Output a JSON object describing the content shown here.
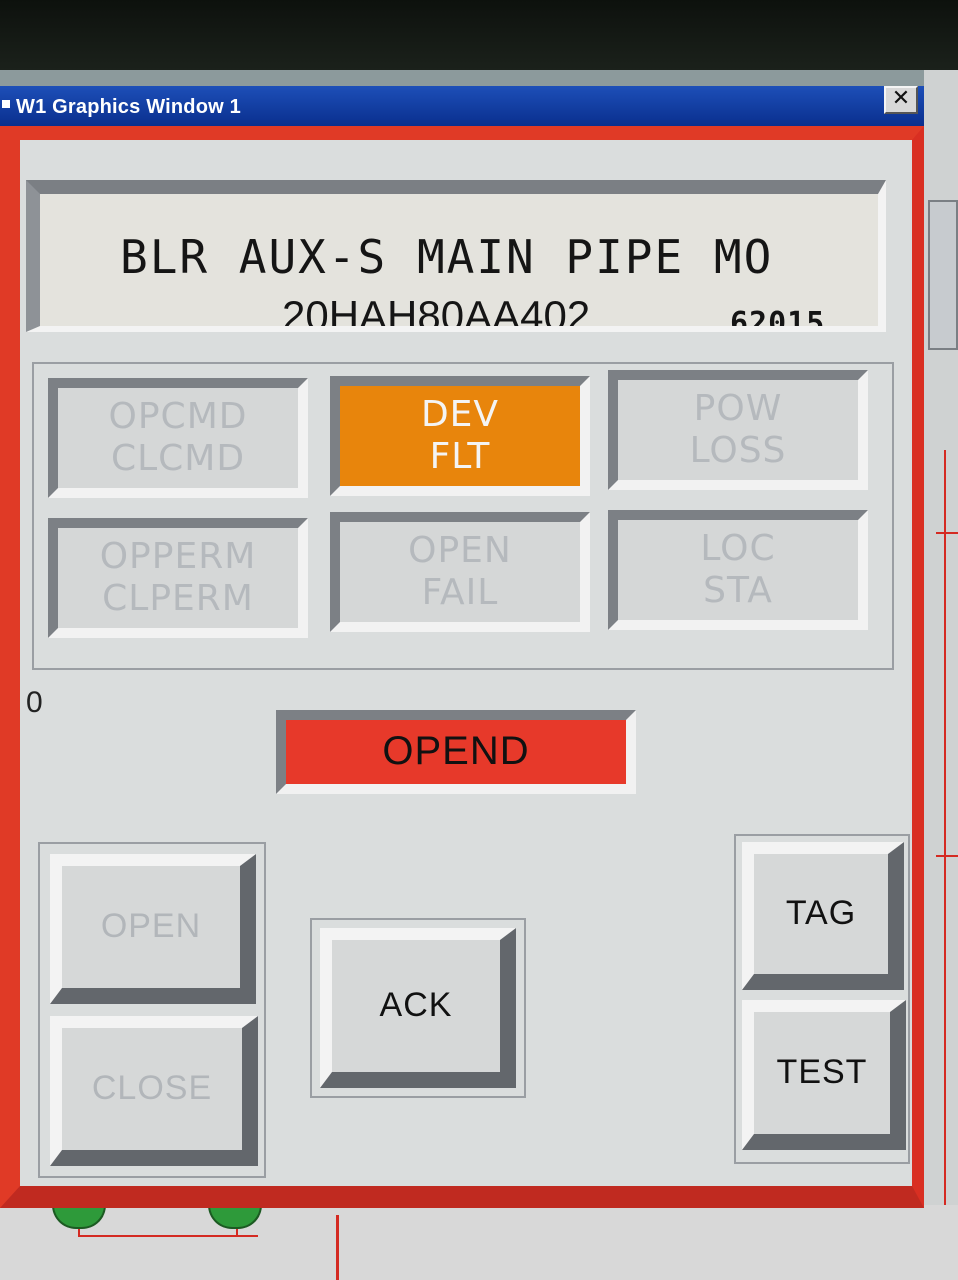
{
  "window": {
    "title": "W1 Graphics Window 1",
    "close_glyph": "✕"
  },
  "header": {
    "title": "BLR AUX-S MAIN PIPE MO",
    "tag": "20HAH80AA402",
    "number": "62015"
  },
  "status_indicators": [
    {
      "line1": "OPCMD",
      "line2": "CLCMD",
      "active": false
    },
    {
      "line1": "DEV",
      "line2": "FLT",
      "active": true
    },
    {
      "line1": "POW",
      "line2": "LOSS",
      "active": false
    },
    {
      "line1": "OPPERM",
      "line2": "CLPERM",
      "active": false
    },
    {
      "line1": "OPEN",
      "line2": "FAIL",
      "active": false
    },
    {
      "line1": "LOC",
      "line2": "STA",
      "active": false
    }
  ],
  "position_value": "0",
  "state_display": "OPEND",
  "buttons": {
    "open": "OPEN",
    "close": "CLOSE",
    "ack": "ACK",
    "tag": "TAG",
    "test": "TEST"
  },
  "colors": {
    "frame_red": "#e03a26",
    "title_blue": "#1d4fb8",
    "alarm_orange": "#e8850c",
    "state_red": "#e7392a"
  }
}
